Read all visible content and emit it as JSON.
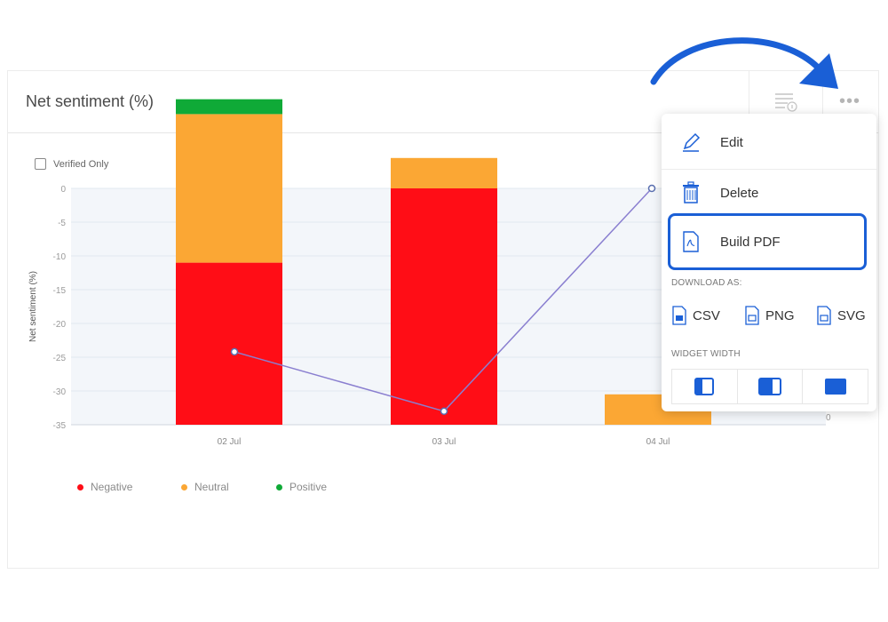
{
  "widget": {
    "title": "Net sentiment (%)",
    "verified_label": "Verified Only",
    "more_icon": "more-dots-icon",
    "filter_icon": "filter-list-icon"
  },
  "chart_data": {
    "type": "bar",
    "categories": [
      "02 Jul",
      "03 Jul",
      "04 Jul"
    ],
    "ylabel": "Net sentiment (%)",
    "yticks": [
      "0",
      "-5",
      "-10",
      "-15",
      "-20",
      "-25",
      "-30",
      "-35"
    ],
    "ylim": [
      -35,
      0
    ],
    "right_axis_tick": "0",
    "grid": true,
    "stacked": true,
    "series": [
      {
        "name": "Negative",
        "color": "#ff0d16",
        "values": [
          -24,
          -35,
          0
        ]
      },
      {
        "name": "Neutral",
        "color": "#fba734",
        "values": [
          -22,
          -4.5,
          -4.5
        ]
      },
      {
        "name": "Positive",
        "color": "#0faa37",
        "values": [
          -2.2,
          0,
          0
        ]
      }
    ],
    "line": {
      "color": "#8a7fd0",
      "values": [
        -24.2,
        -33,
        0
      ]
    },
    "legend_position": "bottom-left"
  },
  "menu": {
    "edit_label": "Edit",
    "delete_label": "Delete",
    "build_pdf_label": "Build PDF",
    "download_label": "DOWNLOAD AS:",
    "downloads": [
      "CSV",
      "PNG",
      "SVG"
    ],
    "widget_width_label": "WIDGET WIDTH",
    "highlight_color": "#1a5fd6"
  },
  "annotation": {
    "arrow_color": "#1a5fd6"
  }
}
